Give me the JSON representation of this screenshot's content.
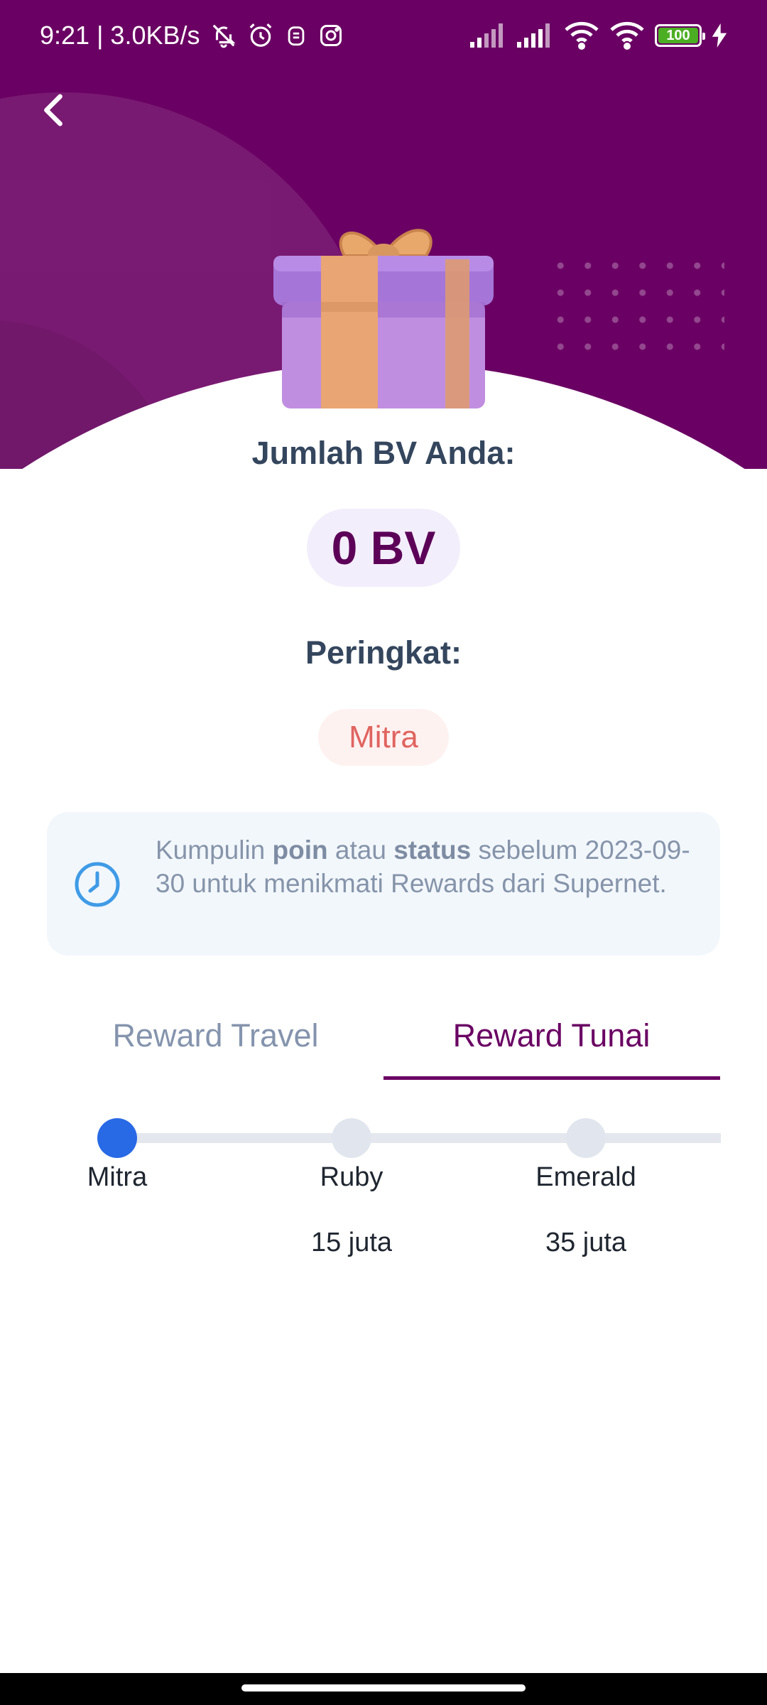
{
  "status_bar": {
    "time_speed": "9:21 | 3.0KB/s",
    "battery": "100"
  },
  "content": {
    "bv_label": "Jumlah BV Anda:",
    "bv_value": "0 BV",
    "rank_label": "Peringkat:",
    "rank_value": "Mitra"
  },
  "info": {
    "part1": "Kumpulin ",
    "bold1": "poin",
    "part2": " atau ",
    "bold2": "status",
    "part3": " sebelum 2023-09-30 untuk menikmati Rewards dari Supernet."
  },
  "tabs": [
    {
      "label": "Reward Travel",
      "active": false
    },
    {
      "label": "Reward Tunai",
      "active": true
    }
  ],
  "tiers": [
    {
      "name": "Mitra",
      "value": "",
      "active": true
    },
    {
      "name": "Ruby",
      "value": "15 juta",
      "active": false
    },
    {
      "name": "Emerald",
      "value": "35 juta",
      "active": false
    }
  ],
  "colors": {
    "brand_purple": "#6a0063",
    "active_node": "#2869e6",
    "rank_text": "#e0645f"
  }
}
